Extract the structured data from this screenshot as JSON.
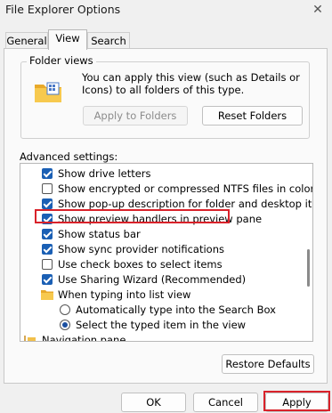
{
  "window": {
    "title": "File Explorer Options",
    "close_glyph": "✕"
  },
  "tabs": [
    {
      "label": "General"
    },
    {
      "label": "View"
    },
    {
      "label": "Search"
    }
  ],
  "folder_views": {
    "title": "Folder views",
    "description": "You can apply this view (such as Details or Icons) to all folders of this type.",
    "apply_label": "Apply to Folders",
    "reset_label": "Reset Folders"
  },
  "advanced": {
    "label": "Advanced settings:",
    "items": [
      {
        "type": "checkbox",
        "checked": true,
        "label": "Show drive letters"
      },
      {
        "type": "checkbox",
        "checked": false,
        "label": "Show encrypted or compressed NTFS files in color"
      },
      {
        "type": "checkbox",
        "checked": true,
        "label": "Show pop-up description for folder and desktop items"
      },
      {
        "type": "checkbox",
        "checked": true,
        "label": "Show preview handlers in preview pane"
      },
      {
        "type": "checkbox",
        "checked": true,
        "label": "Show status bar"
      },
      {
        "type": "checkbox",
        "checked": true,
        "label": "Show sync provider notifications"
      },
      {
        "type": "checkbox",
        "checked": false,
        "label": "Use check boxes to select items"
      },
      {
        "type": "checkbox",
        "checked": true,
        "label": "Use Sharing Wizard (Recommended)"
      },
      {
        "type": "folder",
        "label": "When typing into list view"
      },
      {
        "type": "radio",
        "checked": false,
        "label": "Automatically type into the Search Box"
      },
      {
        "type": "radio",
        "checked": true,
        "label": "Select the typed item in the view"
      },
      {
        "type": "nav",
        "label": "Navigation pane"
      }
    ],
    "restore_label": "Restore Defaults"
  },
  "footer": {
    "ok": "OK",
    "cancel": "Cancel",
    "apply": "Apply"
  },
  "colors": {
    "accent": "#1a5fb4",
    "highlight": "#d9222a",
    "folder": "#f2c04a"
  }
}
